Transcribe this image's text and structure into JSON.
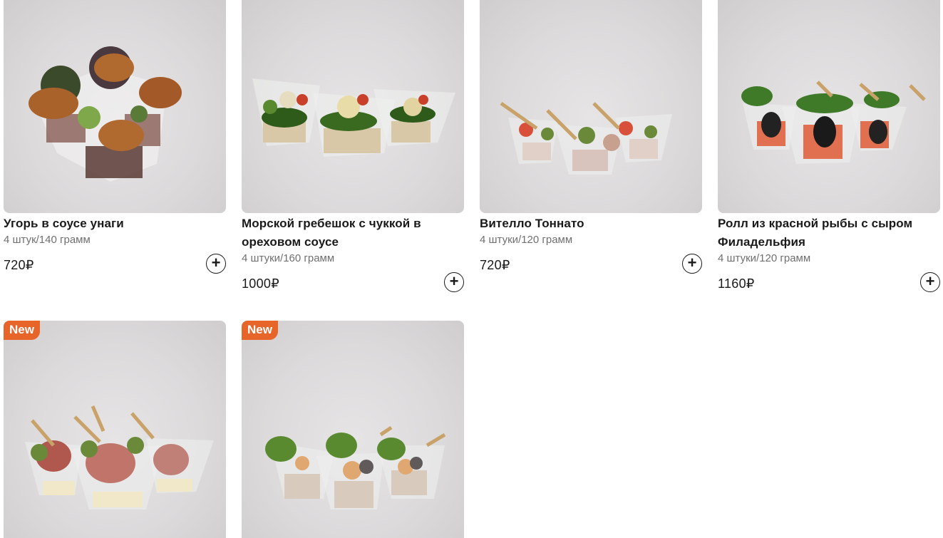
{
  "products": [
    {
      "name": "Угорь в соусе унаги",
      "weight": "4 штук/140 грамм",
      "price": "720₽",
      "add_icon": "+"
    },
    {
      "name": "Морской гребешок с чуккой в ореховом соусе",
      "weight": "4 штуки/160 грамм",
      "price": "1000₽",
      "add_icon": "+"
    },
    {
      "name": "Вителло Тоннато",
      "weight": "4 штуки/120 грамм",
      "price": "720₽",
      "add_icon": "+"
    },
    {
      "name": "Ролл из красной рыбы с сыром Филадельфия",
      "weight": "4 штуки/120 грамм",
      "price": "1160₽",
      "add_icon": "+"
    },
    {
      "badge": "New"
    },
    {
      "badge": "New"
    }
  ],
  "colors": {
    "badge": "#e8652a",
    "text": "#1a1a1a",
    "muted": "#707070"
  }
}
